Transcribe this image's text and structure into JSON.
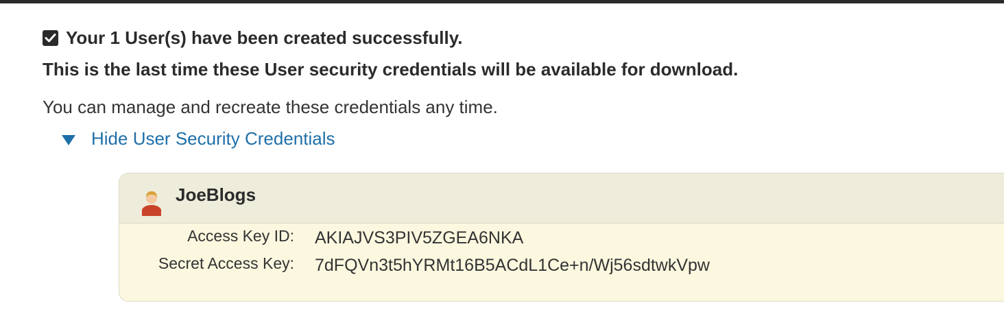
{
  "notice": {
    "success_message": "Your 1 User(s) have been created successfully.",
    "warning_message": "This is the last time these User security credentials will be available for download.",
    "manage_message": "You can manage and recreate these credentials any time.",
    "toggle_label": "Hide User Security Credentials"
  },
  "credentials": {
    "user_name": "JoeBlogs",
    "access_key_label": "Access Key ID:",
    "access_key_value": "AKIAJVS3PIV5ZGEA6NKA",
    "secret_key_label": "Secret Access Key:",
    "secret_key_value": "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"
  },
  "colors": {
    "link": "#1f6fa8",
    "panel_background": "#fbf8df",
    "panel_header": "#eeecdb"
  },
  "icons": {
    "success": "checkbox-checked-icon",
    "toggle": "triangle-down-icon",
    "user": "user-icon"
  }
}
